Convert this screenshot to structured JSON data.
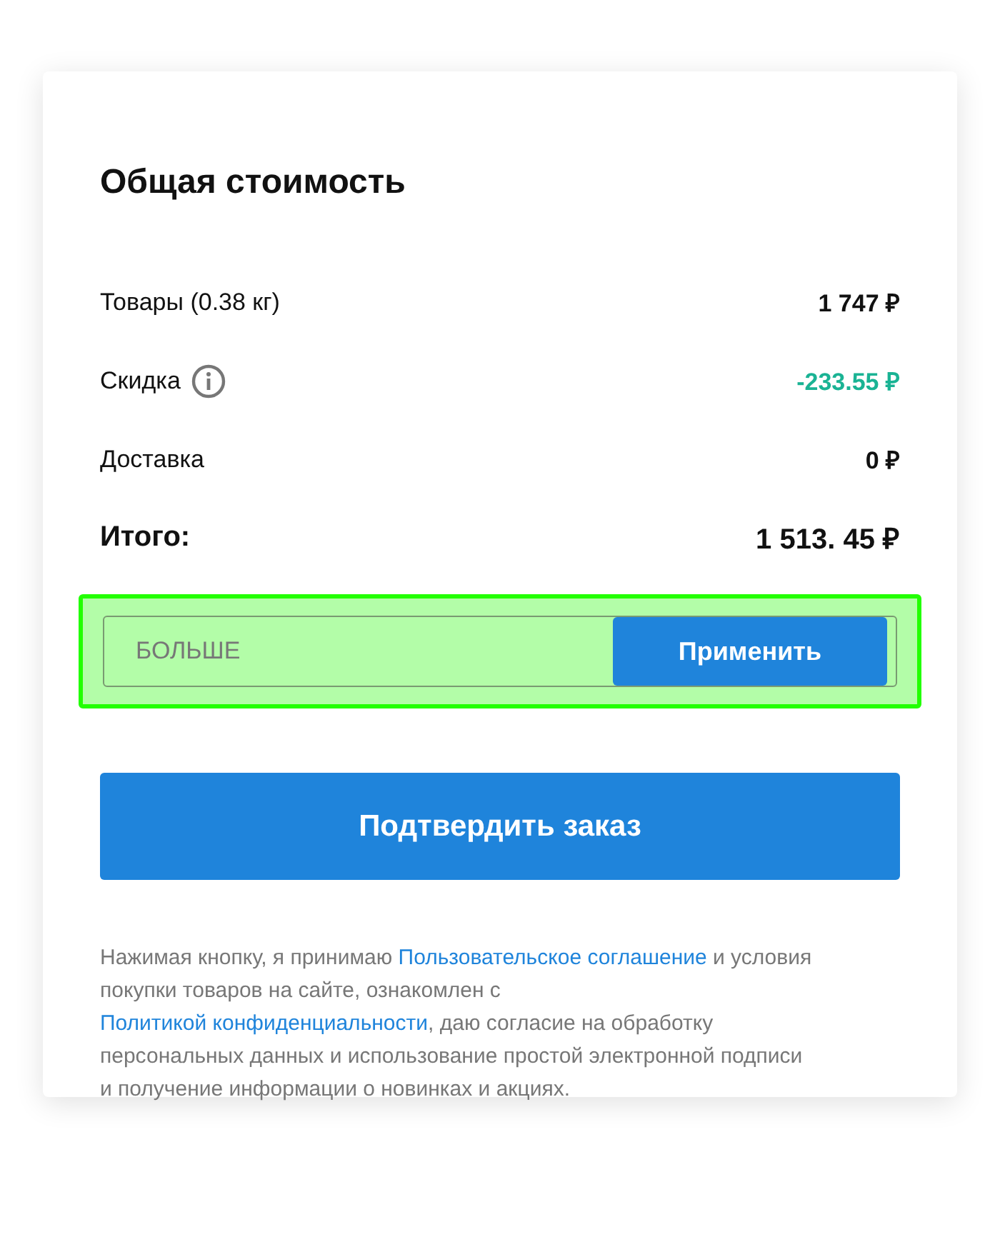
{
  "title": "Общая стоимость",
  "rows": [
    {
      "kind": "plain",
      "label": "Товары (0.38 кг)",
      "info": false,
      "value": "1 747 ₽"
    },
    {
      "kind": "discount",
      "label": "Скидка",
      "info": true,
      "value": "-233.55 ₽"
    },
    {
      "kind": "plain",
      "label": "Доставка",
      "info": false,
      "value": "0 ₽"
    },
    {
      "kind": "total",
      "label": "Итого:",
      "info": false,
      "value": "1 513. 45 ₽"
    }
  ],
  "promo": {
    "value": "БОЛЬШЕ",
    "highlighted": true,
    "button": "Применить"
  },
  "confirm_button": "Подтвердить заказ",
  "legal": [
    {
      "kind": "text",
      "text": "Нажимая кнопку, я принимаю "
    },
    {
      "kind": "link",
      "text": "Пользовательское соглашение"
    },
    {
      "kind": "text",
      "text": " и условия покупки товаров на сайте, ознакомлен с "
    },
    {
      "kind": "link",
      "text": "Политикой конфиденциальности"
    },
    {
      "kind": "text",
      "text": ", даю согласие на обработку персональных данных и использование простой электронной подписи и получение информации о новинках и акциях."
    }
  ]
}
